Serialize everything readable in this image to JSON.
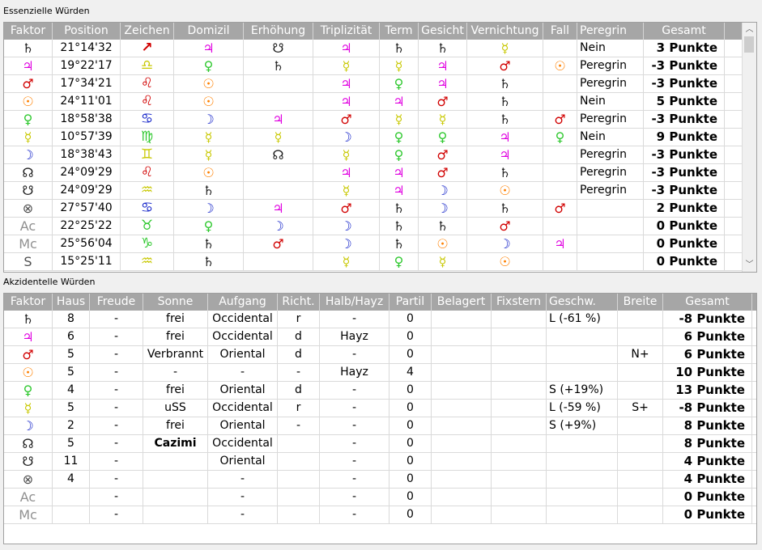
{
  "essential": {
    "title": "Essenzielle Würden",
    "headers": [
      "Faktor",
      "Position",
      "Zeichen",
      "Domizil",
      "Erhöhung",
      "Triplizität",
      "Term",
      "Gesicht",
      "Vernichtung",
      "Fall",
      "Peregrin",
      "Gesamt"
    ],
    "rows": [
      {
        "factor": "♄",
        "factor_color": "#202020",
        "position": "21°14'32",
        "sign": "↗",
        "sign_color": "#d10000",
        "domizil": "♃",
        "domizil_color": "#e000e0",
        "erhoehung": "☋",
        "erhoehung_color": "#202020",
        "trip": "♃",
        "trip_color": "#e000e0",
        "term": "♄",
        "term_color": "#202020",
        "gesicht": "♄",
        "gesicht_color": "#202020",
        "vern": "☿",
        "vern_color": "#c8c800",
        "fall": "",
        "fall_color": "",
        "peregrin": "Nein",
        "gesamt": "3 Punkte"
      },
      {
        "factor": "♃",
        "factor_color": "#e000e0",
        "position": "19°22'17",
        "sign": "♎",
        "sign_color": "#c8c800",
        "domizil": "♀",
        "domizil_color": "#2ec82e",
        "erhoehung": "♄",
        "erhoehung_color": "#202020",
        "trip": "☿",
        "trip_color": "#c8c800",
        "term": "☿",
        "term_color": "#c8c800",
        "gesicht": "♃",
        "gesicht_color": "#e000e0",
        "vern": "♂",
        "vern_color": "#d10000",
        "fall": "☉",
        "fall_color": "#ff8000",
        "peregrin": "Peregrin",
        "gesamt": "-3 Punkte"
      },
      {
        "factor": "♂",
        "factor_color": "#d10000",
        "position": "17°34'21",
        "sign": "♌",
        "sign_color": "#d10000",
        "domizil": "☉",
        "domizil_color": "#ff8000",
        "erhoehung": "",
        "erhoehung_color": "",
        "trip": "♃",
        "trip_color": "#e000e0",
        "term": "♀",
        "term_color": "#2ec82e",
        "gesicht": "♃",
        "gesicht_color": "#e000e0",
        "vern": "♄",
        "vern_color": "#202020",
        "fall": "",
        "fall_color": "",
        "peregrin": "Peregrin",
        "gesamt": "-3 Punkte"
      },
      {
        "factor": "☉",
        "factor_color": "#ff8000",
        "position": "24°11'01",
        "sign": "♌",
        "sign_color": "#d10000",
        "domizil": "☉",
        "domizil_color": "#ff8000",
        "erhoehung": "",
        "erhoehung_color": "",
        "trip": "♃",
        "trip_color": "#e000e0",
        "term": "♃",
        "term_color": "#e000e0",
        "gesicht": "♂",
        "gesicht_color": "#d10000",
        "vern": "♄",
        "vern_color": "#202020",
        "fall": "",
        "fall_color": "",
        "peregrin": "Nein",
        "gesamt": "5 Punkte"
      },
      {
        "factor": "♀",
        "factor_color": "#2ec82e",
        "position": "18°58'38",
        "sign": "♋",
        "sign_color": "#1020c8",
        "domizil": "☽",
        "domizil_color": "#1020c8",
        "erhoehung": "♃",
        "erhoehung_color": "#e000e0",
        "trip": "♂",
        "trip_color": "#d10000",
        "term": "☿",
        "term_color": "#c8c800",
        "gesicht": "☿",
        "gesicht_color": "#c8c800",
        "vern": "♄",
        "vern_color": "#202020",
        "fall": "♂",
        "fall_color": "#d10000",
        "peregrin": "Peregrin",
        "gesamt": "-3 Punkte"
      },
      {
        "factor": "☿",
        "factor_color": "#c8c800",
        "position": "10°57'39",
        "sign": "♍",
        "sign_color": "#2ec82e",
        "domizil": "☿",
        "domizil_color": "#c8c800",
        "erhoehung": "☿",
        "erhoehung_color": "#c8c800",
        "trip": "☽",
        "trip_color": "#1020c8",
        "term": "♀",
        "term_color": "#2ec82e",
        "gesicht": "♀",
        "gesicht_color": "#2ec82e",
        "vern": "♃",
        "vern_color": "#e000e0",
        "fall": "♀",
        "fall_color": "#2ec82e",
        "peregrin": "Nein",
        "gesamt": "9 Punkte"
      },
      {
        "factor": "☽",
        "factor_color": "#1020c8",
        "position": "18°38'43",
        "sign": "♊",
        "sign_color": "#c8c800",
        "domizil": "☿",
        "domizil_color": "#c8c800",
        "erhoehung": "☊",
        "erhoehung_color": "#202020",
        "trip": "☿",
        "trip_color": "#c8c800",
        "term": "♀",
        "term_color": "#2ec82e",
        "gesicht": "♂",
        "gesicht_color": "#d10000",
        "vern": "♃",
        "vern_color": "#e000e0",
        "fall": "",
        "fall_color": "",
        "peregrin": "Peregrin",
        "gesamt": "-3 Punkte"
      },
      {
        "factor": "☊",
        "factor_color": "#202020",
        "position": "24°09'29",
        "sign": "♌",
        "sign_color": "#d10000",
        "domizil": "☉",
        "domizil_color": "#ff8000",
        "erhoehung": "",
        "erhoehung_color": "",
        "trip": "♃",
        "trip_color": "#e000e0",
        "term": "♃",
        "term_color": "#e000e0",
        "gesicht": "♂",
        "gesicht_color": "#d10000",
        "vern": "♄",
        "vern_color": "#202020",
        "fall": "",
        "fall_color": "",
        "peregrin": "Peregrin",
        "gesamt": "-3 Punkte"
      },
      {
        "factor": "☋",
        "factor_color": "#202020",
        "position": "24°09'29",
        "sign": "♒",
        "sign_color": "#c8c800",
        "domizil": "♄",
        "domizil_color": "#202020",
        "erhoehung": "",
        "erhoehung_color": "",
        "trip": "☿",
        "trip_color": "#c8c800",
        "term": "♃",
        "term_color": "#e000e0",
        "gesicht": "☽",
        "gesicht_color": "#1020c8",
        "vern": "☉",
        "vern_color": "#ff8000",
        "fall": "",
        "fall_color": "",
        "peregrin": "Peregrin",
        "gesamt": "-3 Punkte"
      },
      {
        "factor": "⊗",
        "factor_color": "#505050",
        "position": "27°57'40",
        "sign": "♋",
        "sign_color": "#1020c8",
        "domizil": "☽",
        "domizil_color": "#1020c8",
        "erhoehung": "♃",
        "erhoehung_color": "#e000e0",
        "trip": "♂",
        "trip_color": "#d10000",
        "term": "♄",
        "term_color": "#202020",
        "gesicht": "☽",
        "gesicht_color": "#1020c8",
        "vern": "♄",
        "vern_color": "#202020",
        "fall": "♂",
        "fall_color": "#d10000",
        "peregrin": "",
        "gesamt": "2 Punkte"
      },
      {
        "factor": "Ac",
        "factor_color": "#909090",
        "position": "22°25'22",
        "sign": "♉",
        "sign_color": "#2ec82e",
        "domizil": "♀",
        "domizil_color": "#2ec82e",
        "erhoehung": "☽",
        "erhoehung_color": "#1020c8",
        "trip": "☽",
        "trip_color": "#1020c8",
        "term": "♄",
        "term_color": "#202020",
        "gesicht": "♄",
        "gesicht_color": "#202020",
        "vern": "♂",
        "vern_color": "#d10000",
        "fall": "",
        "fall_color": "",
        "peregrin": "",
        "gesamt": "0 Punkte"
      },
      {
        "factor": "Mc",
        "factor_color": "#909090",
        "position": "25°56'04",
        "sign": "♑",
        "sign_color": "#2ec82e",
        "domizil": "♄",
        "domizil_color": "#202020",
        "erhoehung": "♂",
        "erhoehung_color": "#d10000",
        "trip": "☽",
        "trip_color": "#1020c8",
        "term": "♄",
        "term_color": "#202020",
        "gesicht": "☉",
        "gesicht_color": "#ff8000",
        "vern": "☽",
        "vern_color": "#1020c8",
        "fall": "♃",
        "fall_color": "#e000e0",
        "peregrin": "",
        "gesamt": "0 Punkte"
      },
      {
        "factor": "S",
        "factor_color": "#505050",
        "position": "15°25'11",
        "sign": "♒",
        "sign_color": "#c8c800",
        "domizil": "♄",
        "domizil_color": "#202020",
        "erhoehung": "",
        "erhoehung_color": "",
        "trip": "☿",
        "trip_color": "#c8c800",
        "term": "♀",
        "term_color": "#2ec82e",
        "gesicht": "☿",
        "gesicht_color": "#c8c800",
        "vern": "☉",
        "vern_color": "#ff8000",
        "fall": "",
        "fall_color": "",
        "peregrin": "",
        "gesamt": "0 Punkte"
      }
    ]
  },
  "accidental": {
    "title": "Akzidentelle Würden",
    "headers": [
      "Faktor",
      "Haus",
      "Freude",
      "Sonne",
      "Aufgang",
      "Richt.",
      "Halb/Hayz",
      "Partil",
      "Belagert",
      "Fixstern",
      "Geschw.",
      "Breite",
      "Gesamt"
    ],
    "rows": [
      {
        "factor": "♄",
        "factor_color": "#202020",
        "haus": "8",
        "freude": "-",
        "sonne": "frei",
        "sonne_bold": false,
        "aufgang": "Occidental",
        "richt": "r",
        "hayz": "-",
        "partil": "0",
        "belagert": "",
        "fixstern": "",
        "geschw": "L (-61 %)",
        "breite": "",
        "gesamt": "-8 Punkte"
      },
      {
        "factor": "♃",
        "factor_color": "#e000e0",
        "haus": "6",
        "freude": "-",
        "sonne": "frei",
        "sonne_bold": false,
        "aufgang": "Occidental",
        "richt": "d",
        "hayz": "Hayz",
        "partil": "0",
        "belagert": "",
        "fixstern": "",
        "geschw": "",
        "breite": "",
        "gesamt": "6 Punkte"
      },
      {
        "factor": "♂",
        "factor_color": "#d10000",
        "haus": "5",
        "freude": "-",
        "sonne": "Verbrannt",
        "sonne_bold": false,
        "aufgang": "Oriental",
        "richt": "d",
        "hayz": "-",
        "partil": "0",
        "belagert": "",
        "fixstern": "",
        "geschw": "",
        "breite": "N+",
        "gesamt": "6 Punkte"
      },
      {
        "factor": "☉",
        "factor_color": "#ff8000",
        "haus": "5",
        "freude": "-",
        "sonne": "-",
        "sonne_bold": false,
        "aufgang": "-",
        "richt": "-",
        "hayz": "Hayz",
        "partil": "4",
        "belagert": "",
        "fixstern": "",
        "geschw": "",
        "breite": "",
        "gesamt": "10 Punkte"
      },
      {
        "factor": "♀",
        "factor_color": "#2ec82e",
        "haus": "4",
        "freude": "-",
        "sonne": "frei",
        "sonne_bold": false,
        "aufgang": "Oriental",
        "richt": "d",
        "hayz": "-",
        "partil": "0",
        "belagert": "",
        "fixstern": "",
        "geschw": "S (+19%)",
        "breite": "",
        "gesamt": "13 Punkte"
      },
      {
        "factor": "☿",
        "factor_color": "#c8c800",
        "haus": "5",
        "freude": "-",
        "sonne": "uSS",
        "sonne_bold": false,
        "aufgang": "Occidental",
        "richt": "r",
        "hayz": "-",
        "partil": "0",
        "belagert": "",
        "fixstern": "",
        "geschw": "L (-59 %)",
        "breite": "S+",
        "gesamt": "-8 Punkte"
      },
      {
        "factor": "☽",
        "factor_color": "#1020c8",
        "haus": "2",
        "freude": "-",
        "sonne": "frei",
        "sonne_bold": false,
        "aufgang": "Oriental",
        "richt": "-",
        "hayz": "-",
        "partil": "0",
        "belagert": "",
        "fixstern": "",
        "geschw": "S (+9%)",
        "breite": "",
        "gesamt": "8 Punkte"
      },
      {
        "factor": "☊",
        "factor_color": "#202020",
        "haus": "5",
        "freude": "-",
        "sonne": "Cazimi",
        "sonne_bold": true,
        "aufgang": "Occidental",
        "richt": "",
        "hayz": "-",
        "partil": "0",
        "belagert": "",
        "fixstern": "",
        "geschw": "",
        "breite": "",
        "gesamt": "8 Punkte"
      },
      {
        "factor": "☋",
        "factor_color": "#202020",
        "haus": "11",
        "freude": "-",
        "sonne": "",
        "sonne_bold": false,
        "aufgang": "Oriental",
        "richt": "",
        "hayz": "-",
        "partil": "0",
        "belagert": "",
        "fixstern": "",
        "geschw": "",
        "breite": "",
        "gesamt": "4 Punkte"
      },
      {
        "factor": "⊗",
        "factor_color": "#505050",
        "haus": "4",
        "freude": "-",
        "sonne": "",
        "sonne_bold": false,
        "aufgang": "-",
        "richt": "",
        "hayz": "-",
        "partil": "0",
        "belagert": "",
        "fixstern": "",
        "geschw": "",
        "breite": "",
        "gesamt": "4 Punkte"
      },
      {
        "factor": "Ac",
        "factor_color": "#909090",
        "haus": "",
        "freude": "-",
        "sonne": "",
        "sonne_bold": false,
        "aufgang": "-",
        "richt": "",
        "hayz": "-",
        "partil": "0",
        "belagert": "",
        "fixstern": "",
        "geschw": "",
        "breite": "",
        "gesamt": "0 Punkte"
      },
      {
        "factor": "Mc",
        "factor_color": "#909090",
        "haus": "",
        "freude": "-",
        "sonne": "",
        "sonne_bold": false,
        "aufgang": "-",
        "richt": "",
        "hayz": "-",
        "partil": "0",
        "belagert": "",
        "fixstern": "",
        "geschw": "",
        "breite": "",
        "gesamt": "0 Punkte"
      }
    ]
  },
  "scrollbar": {
    "up_icon": "chevron-up-icon",
    "down_icon": "chevron-down-icon"
  }
}
